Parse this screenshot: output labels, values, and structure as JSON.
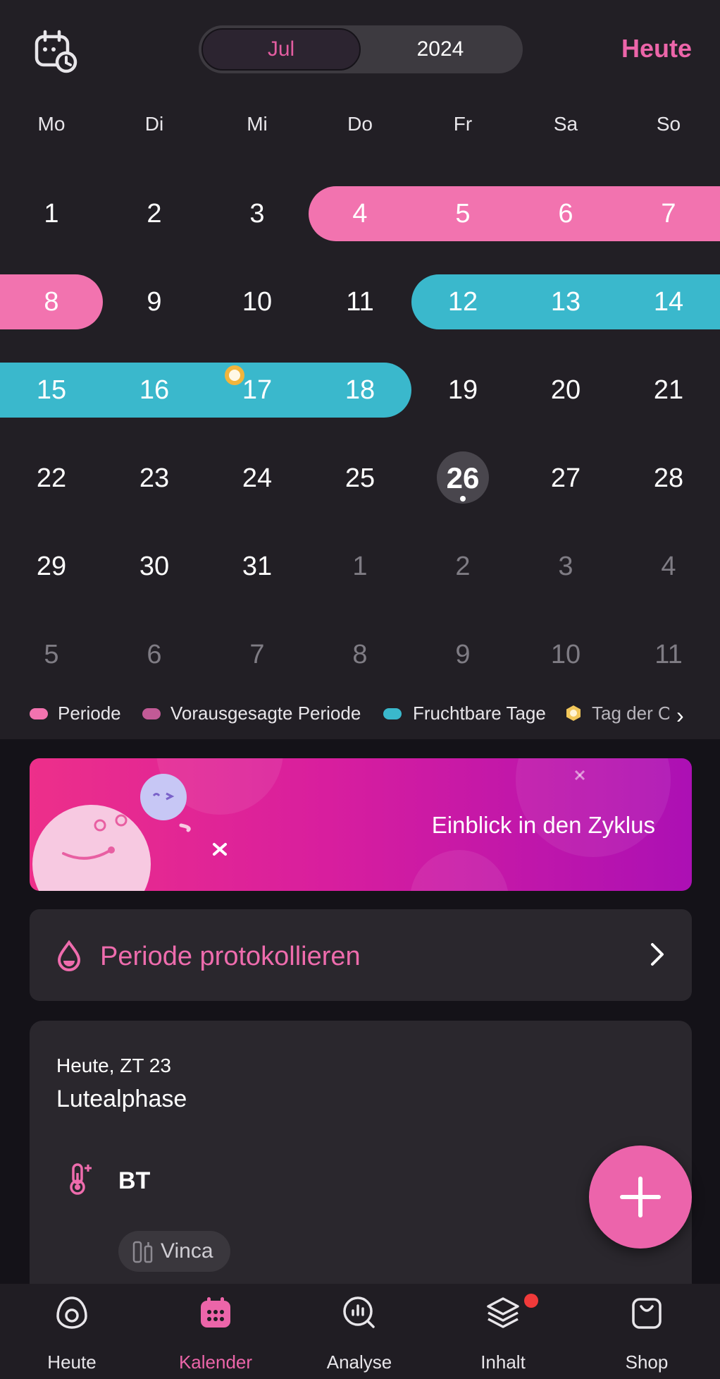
{
  "header": {
    "month": "Jul",
    "year": "2024",
    "today_button": "Heute"
  },
  "weekdays": [
    "Mo",
    "Di",
    "Mi",
    "Do",
    "Fr",
    "Sa",
    "So"
  ],
  "calendar": {
    "rows": [
      [
        "1",
        "2",
        "3",
        "4",
        "5",
        "6",
        "7"
      ],
      [
        "8",
        "9",
        "10",
        "11",
        "12",
        "13",
        "14"
      ],
      [
        "15",
        "16",
        "17",
        "18",
        "19",
        "20",
        "21"
      ],
      [
        "22",
        "23",
        "24",
        "25",
        "26",
        "27",
        "28"
      ],
      [
        "29",
        "30",
        "31",
        "1",
        "2",
        "3",
        "4"
      ],
      [
        "5",
        "6",
        "7",
        "8",
        "9",
        "10",
        "11"
      ]
    ],
    "today": "26",
    "period_days": [
      "4",
      "5",
      "6",
      "7",
      "8"
    ],
    "fertile_days": [
      "12",
      "13",
      "14",
      "15",
      "16",
      "17",
      "18"
    ],
    "ovulation_day": "17"
  },
  "legend": {
    "period": "Periode",
    "predicted_period": "Vorausgesagte Periode",
    "fertile": "Fruchtbare Tage",
    "ovulation": "Tag der Ov"
  },
  "banner": {
    "title": "Einblick in den Zyklus"
  },
  "log_period": {
    "label": "Periode protokollieren"
  },
  "info": {
    "date_line": "Heute, ZT 23",
    "phase": "Lutealphase",
    "bt_label": "BT",
    "chip_label": "Vinca"
  },
  "nav": [
    {
      "label": "Heute"
    },
    {
      "label": "Kalender"
    },
    {
      "label": "Analyse"
    },
    {
      "label": "Inhalt"
    },
    {
      "label": "Shop"
    }
  ],
  "colors": {
    "accent": "#ec65a9",
    "period": "#f273af",
    "fertile": "#3ab8cc",
    "predicted_period": "#c25a96",
    "ovulation": "#f2b53c",
    "background": "#221f25"
  }
}
